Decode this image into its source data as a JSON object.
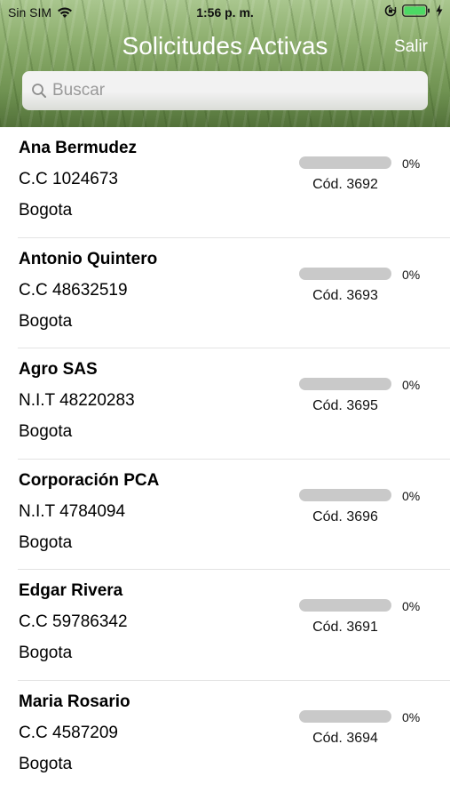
{
  "status_bar": {
    "carrier": "Sin SIM",
    "time": "1:56 p. m.",
    "icons": [
      "wifi-icon",
      "rotation-lock-icon",
      "battery-icon",
      "charging-bolt-icon"
    ],
    "battery_color": "#4cd964"
  },
  "nav": {
    "title": "Solicitudes Activas",
    "exit_label": "Salir"
  },
  "search": {
    "value": "",
    "placeholder": "Buscar"
  },
  "colors": {
    "header_green": "#7b9d5c",
    "progress_track": "#c9c9c9",
    "progress_fill": "#7fae4d"
  },
  "requests": [
    {
      "name": "Ana Bermudez",
      "doc": "C.C 1024673",
      "city": "Bogota",
      "progress": 0,
      "progress_label": "0%",
      "code": "Cód. 3692"
    },
    {
      "name": "Antonio Quintero",
      "doc": "C.C 48632519",
      "city": "Bogota",
      "progress": 0,
      "progress_label": "0%",
      "code": "Cód. 3693"
    },
    {
      "name": "Agro SAS",
      "doc": "N.I.T 48220283",
      "city": "Bogota",
      "progress": 0,
      "progress_label": "0%",
      "code": "Cód. 3695"
    },
    {
      "name": "Corporación PCA",
      "doc": "N.I.T 4784094",
      "city": "Bogota",
      "progress": 0,
      "progress_label": "0%",
      "code": "Cód. 3696"
    },
    {
      "name": "Edgar Rivera",
      "doc": "C.C 59786342",
      "city": "Bogota",
      "progress": 0,
      "progress_label": "0%",
      "code": "Cód. 3691"
    },
    {
      "name": "Maria Rosario",
      "doc": "C.C 4587209",
      "city": "Bogota",
      "progress": 0,
      "progress_label": "0%",
      "code": "Cód. 3694"
    }
  ]
}
